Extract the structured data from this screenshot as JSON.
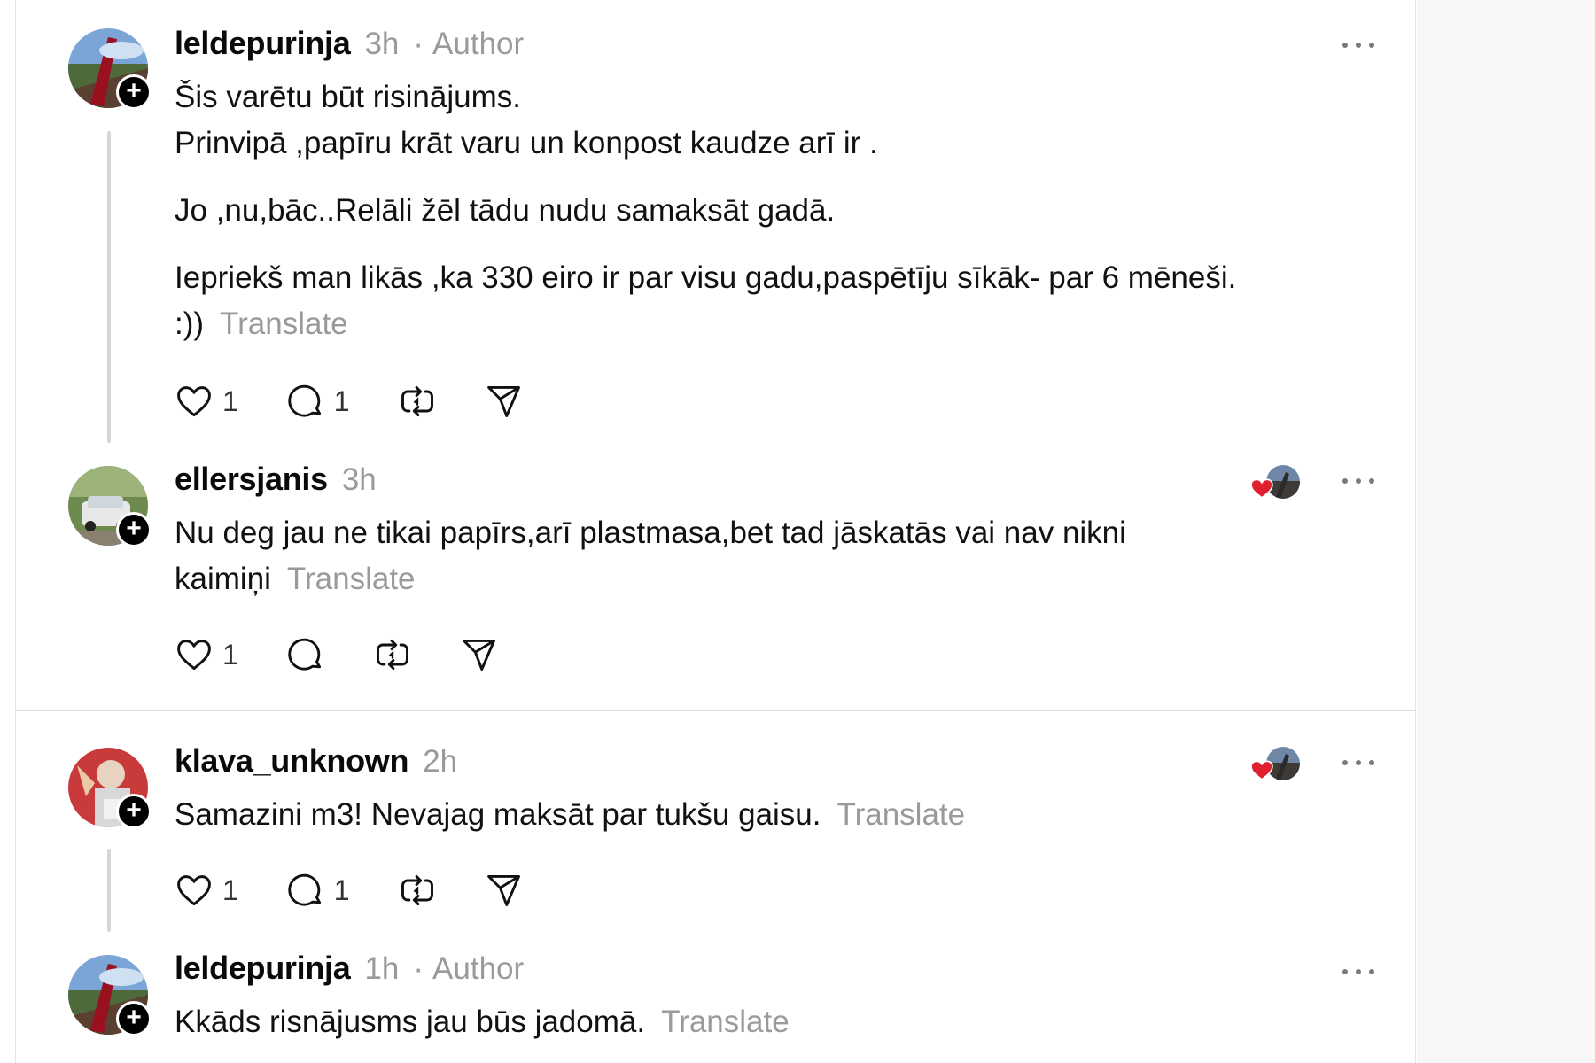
{
  "posts": [
    {
      "username": "leldepurinja",
      "time": "3h",
      "author_sep": "·",
      "author_label": "Author",
      "lines": [
        "Šis varētu būt risinājums.",
        "Prinvipā ,papīru krāt varu un konpost kaudze arī ir ."
      ],
      "para2": "Jo ,nu,bāc..Relāli žēl tādu nudu samaksāt gadā.",
      "para3_line1": "Iepriekš man likās ,ka 330 eiro ir par visu gadu,paspētīju sīkāk- par 6 mēneši.",
      "para3_line2": ":))",
      "translate": "Translate",
      "likes": "1",
      "replies": "1"
    },
    {
      "username": "ellersjanis",
      "time": "3h",
      "line1": "Nu deg jau ne tikai papīrs,arī plastmasa,bet tad jāskatās vai nav nikni",
      "line2": "kaimiņi",
      "translate": "Translate",
      "likes": "1"
    },
    {
      "username": "klava_unknown",
      "time": "2h",
      "line1": "Samazini m3! Nevajag maksāt par tukšu gaisu.",
      "translate": "Translate",
      "likes": "1",
      "replies": "1"
    },
    {
      "username": "leldepurinja",
      "time": "1h",
      "author_sep": "·",
      "author_label": "Author",
      "line1": "Kkāds risnājusms jau būs jadomā.",
      "translate": "Translate"
    }
  ],
  "colors": {
    "heart": "#e0202e",
    "muted": "#9a9a9a",
    "thread_line": "#d6d6d6"
  },
  "icons": [
    "heart-icon",
    "comment-icon",
    "repost-icon",
    "share-icon",
    "more-icon",
    "plus-icon"
  ]
}
